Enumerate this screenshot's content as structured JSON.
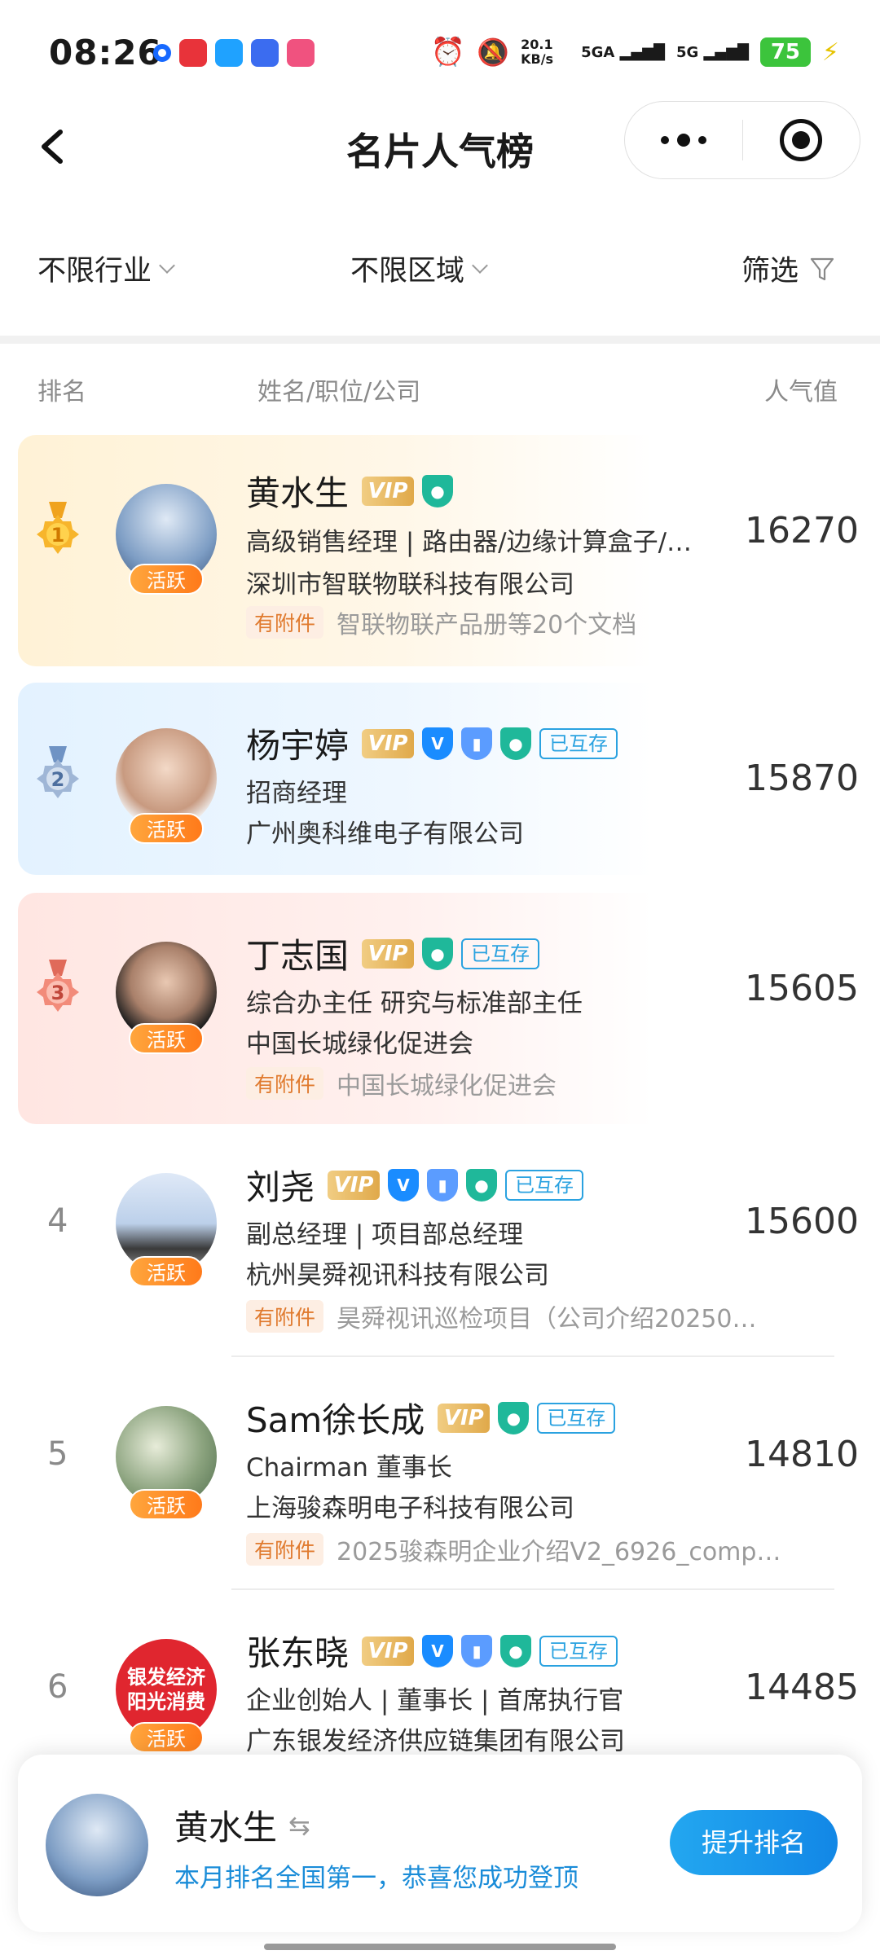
{
  "status_bar": {
    "time": "08:26",
    "net_speed": "20.1 KB/s",
    "sig1": "5GA",
    "sig2": "5G",
    "battery": "75"
  },
  "nav": {
    "title": "名片人气榜"
  },
  "filters": {
    "industry": "不限行业",
    "region": "不限区域",
    "screen": "筛选"
  },
  "table_header": {
    "rank": "排名",
    "info": "姓名/职位/公司",
    "score": "人气值"
  },
  "badges": {
    "vip": "VIP",
    "mutual": "已互存",
    "attachment": "有附件",
    "active": "活跃"
  },
  "rows": [
    {
      "rank": "1",
      "name": "黄水生",
      "title": "高级销售经理 | 路由器/边缘计算盒子/…",
      "company": "深圳市智联物联科技有限公司",
      "attachment": "智联物联产品册等20个文档",
      "score": "16270"
    },
    {
      "rank": "2",
      "name": "杨宇婷",
      "title": "招商经理",
      "company": "广州奥科维电子有限公司",
      "score": "15870"
    },
    {
      "rank": "3",
      "name": "丁志国",
      "title": "综合办主任 研究与标准部主任",
      "company": "中国长城绿化促进会",
      "attachment": "中国长城绿化促进会",
      "score": "15605"
    },
    {
      "rank": "4",
      "name": "刘尧",
      "title": "副总经理 | 项目部总经理",
      "company": "杭州昊舜视讯科技有限公司",
      "attachment": "昊舜视讯巡检项目（公司介绍20250…",
      "score": "15600"
    },
    {
      "rank": "5",
      "name": "Sam徐长成",
      "title": "Chairman 董事长",
      "company": "上海骏森明电子科技有限公司",
      "attachment": "2025骏森明企业介绍V2_6926_comp…",
      "score": "14810"
    },
    {
      "rank": "6",
      "name": "张东晓",
      "title": "企业创始人 | 董事长 | 首席执行官",
      "company": "广东银发经济供应链集团有限公司",
      "score": "14485",
      "avatar_text": "银发经济阳光消费"
    }
  ],
  "my_card": {
    "name": "黄水生",
    "message": "本月排名全国第一，恭喜您成功登顶",
    "button": "提升排名"
  }
}
